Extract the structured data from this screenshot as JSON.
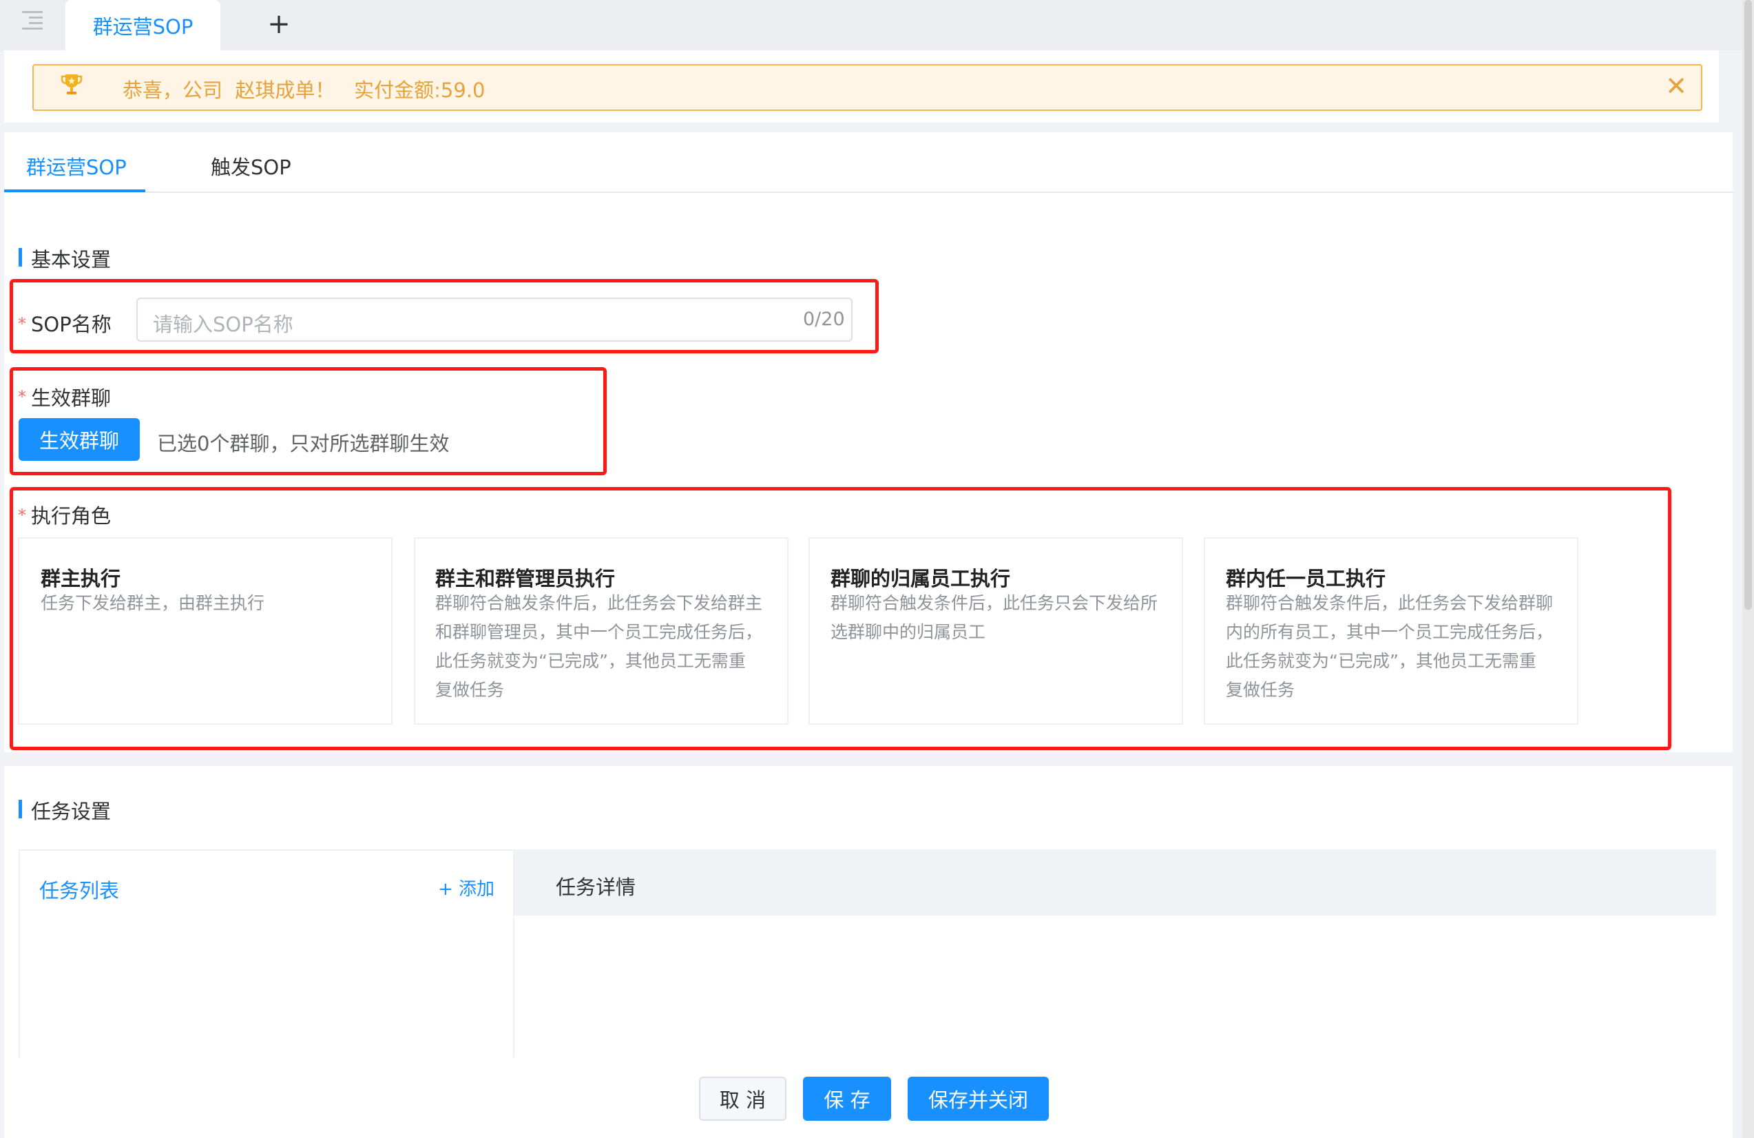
{
  "topbar": {
    "active_tab": "群运营SOP",
    "add_tab": "+"
  },
  "notice": {
    "message": "恭喜，公司  赵琪成单！   实付金额:59.0",
    "close": "✕"
  },
  "page_tabs": [
    {
      "label": "群运营SOP",
      "active": true
    },
    {
      "label": "触发SOP",
      "active": false
    }
  ],
  "basic_settings": {
    "title": "基本设置",
    "sop_name": {
      "required_mark": "*",
      "label": "SOP名称",
      "placeholder": "请输入SOP名称",
      "value": "",
      "count": "0/20"
    },
    "groups": {
      "required_mark": "*",
      "label": "生效群聊",
      "button": "生效群聊",
      "hint": "已选0个群聊，只对所选群聊生效"
    },
    "roles": {
      "required_mark": "*",
      "label": "执行角色",
      "options": [
        {
          "title": "群主执行",
          "desc": "任务下发给群主，由群主执行"
        },
        {
          "title": "群主和群管理员执行",
          "desc": "群聊符合触发条件后，此任务会下发给群主\n和群聊管理员，其中一个员工完成任务后，\n此任务就变为“已完成”，其他员工无需重\n复做任务"
        },
        {
          "title": "群聊的归属员工执行",
          "desc": "群聊符合触发条件后，此任务只会下发给所\n选群聊中的归属员工"
        },
        {
          "title": "群内任一员工执行",
          "desc": "群聊符合触发条件后，此任务会下发给群聊\n内的所有员工，其中一个员工完成任务后，\n此任务就变为“已完成”，其他员工无需重\n复做任务"
        }
      ]
    }
  },
  "task_settings": {
    "title": "任务设置",
    "list_title": "任务列表",
    "add": "+ 添加",
    "detail_title": "任务详情"
  },
  "footer": {
    "cancel": "取 消",
    "save": "保 存",
    "save_close": "保存并关闭"
  },
  "colors": {
    "primary": "#1890ff",
    "warning": "#e6a23c",
    "highlight_box": "#ff1a1a"
  }
}
